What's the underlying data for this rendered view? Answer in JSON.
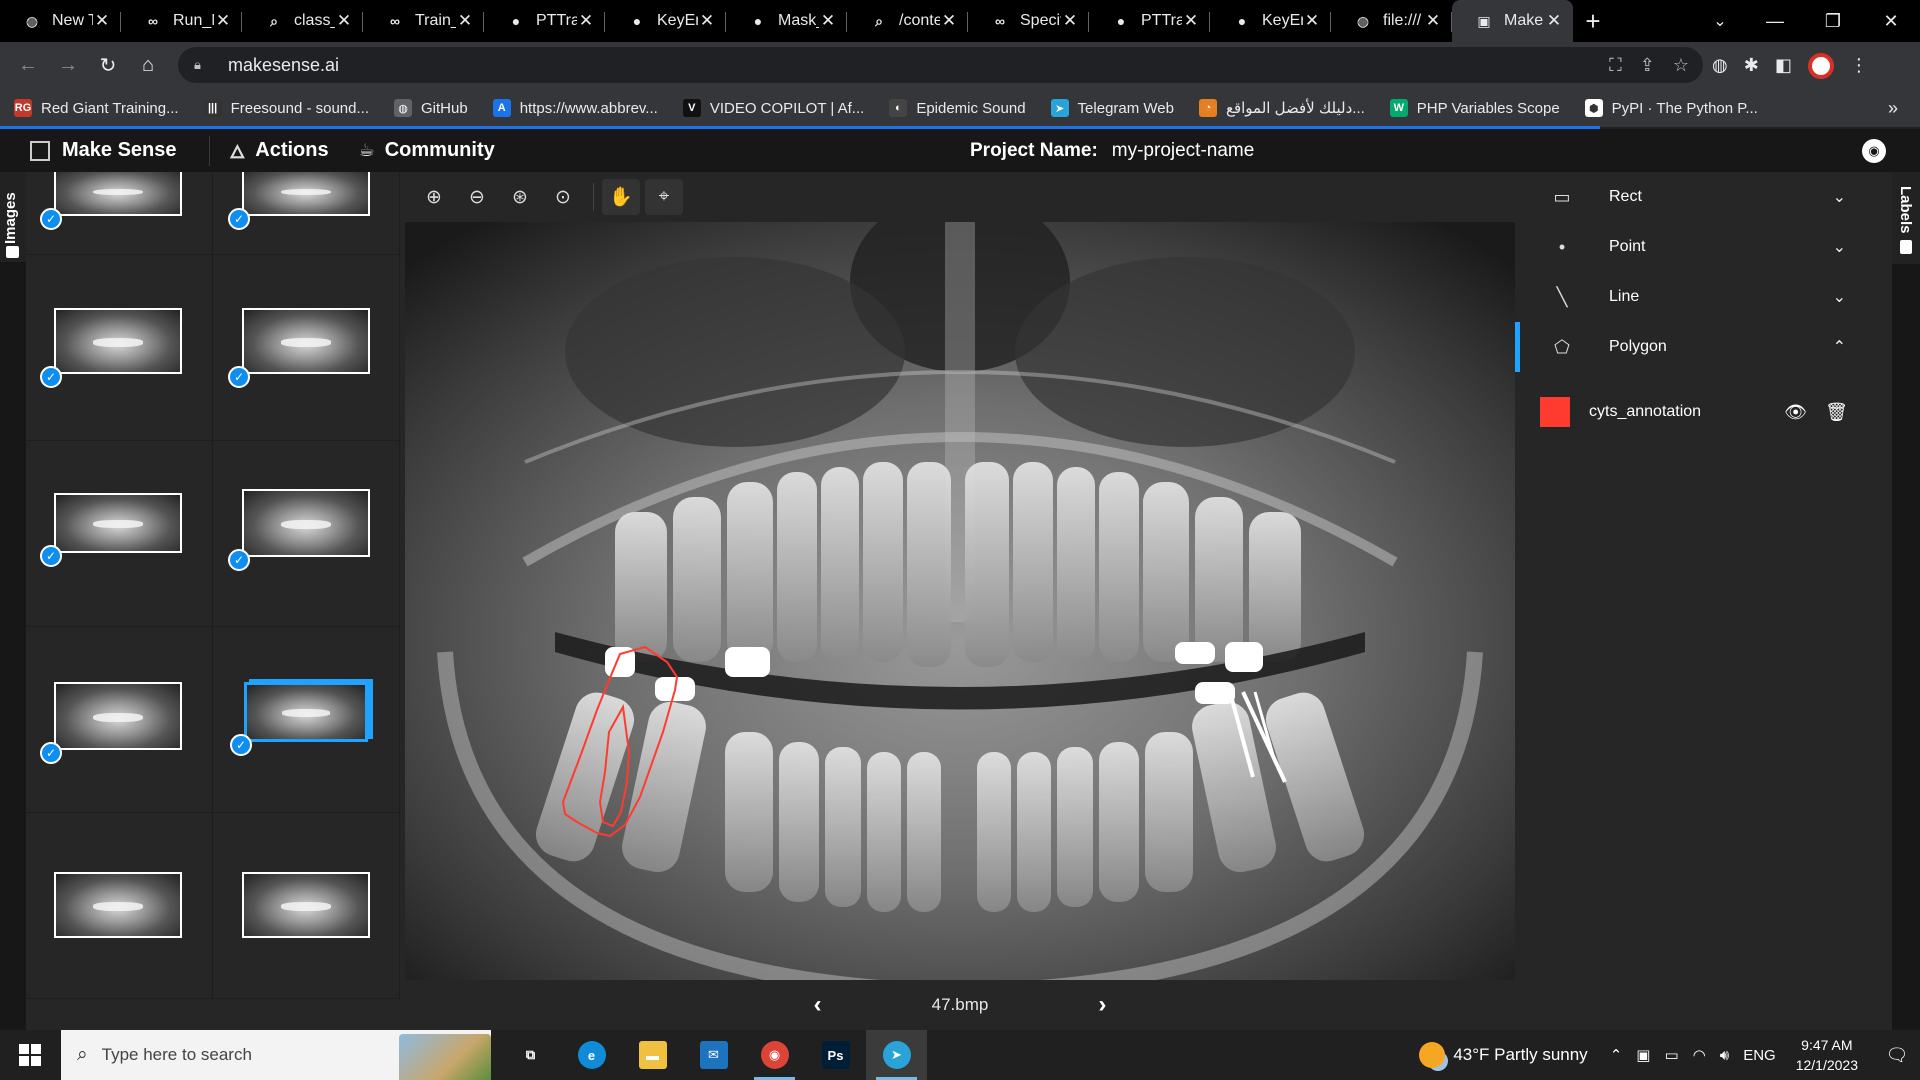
{
  "browser": {
    "tabs": [
      {
        "title": "New T",
        "icon": "globe-icon",
        "glyph": "◍"
      },
      {
        "title": "Run_N",
        "icon": "colab-icon",
        "glyph": "∞"
      },
      {
        "title": "class_i",
        "icon": "search-icon",
        "glyph": "⌕"
      },
      {
        "title": "Train_",
        "icon": "colab-icon",
        "glyph": "∞"
      },
      {
        "title": "PTTra:",
        "icon": "github-icon",
        "glyph": "●"
      },
      {
        "title": "KeyEr",
        "icon": "github-icon",
        "glyph": "●"
      },
      {
        "title": "Mask_",
        "icon": "github-icon",
        "glyph": "●"
      },
      {
        "title": "/conte",
        "icon": "search-icon",
        "glyph": "⌕"
      },
      {
        "title": "Specif",
        "icon": "colab-icon",
        "glyph": "∞"
      },
      {
        "title": "PTTra:",
        "icon": "github-icon",
        "glyph": "●"
      },
      {
        "title": "KeyEr",
        "icon": "github-icon",
        "glyph": "●"
      },
      {
        "title": "file:///",
        "icon": "globe-icon",
        "glyph": "◍"
      },
      {
        "title": "Make",
        "icon": "makesense-icon",
        "glyph": "▣",
        "active": true
      }
    ],
    "close_glyph": "✕",
    "new_tab_glyph": "+",
    "url": "makesense.ai",
    "bookmarks": [
      {
        "label": "Red Giant Training...",
        "icon": "red-giant-icon",
        "color": "#c0392b",
        "glyph": "RG"
      },
      {
        "label": "Freesound - sound...",
        "icon": "freesound-icon",
        "color": "#333333",
        "glyph": "|||"
      },
      {
        "label": "GitHub",
        "icon": "globe-icon",
        "color": "#5f6368",
        "glyph": "◍"
      },
      {
        "label": "https://www.abbrev...",
        "icon": "abbreviations-icon",
        "color": "#1a73e8",
        "glyph": "A"
      },
      {
        "label": "VIDEO COPILOT | Af...",
        "icon": "video-copilot-icon",
        "color": "#111111",
        "glyph": "V"
      },
      {
        "label": "Epidemic Sound",
        "icon": "epidemic-sound-icon",
        "color": "#444444",
        "glyph": "◐"
      },
      {
        "label": "Telegram Web",
        "icon": "telegram-icon",
        "color": "#2aa3d8",
        "glyph": "➤"
      },
      {
        "label": "دليلك لأفضل المواقع...",
        "icon": "guide-icon",
        "color": "#e67e22",
        "glyph": "◔"
      },
      {
        "label": "PHP Variables Scope",
        "icon": "w3schools-icon",
        "color": "#04aa6d",
        "glyph": "W"
      },
      {
        "label": "PyPI · The Python P...",
        "icon": "pypi-icon",
        "color": "#ffffff",
        "glyph": "⬢"
      }
    ],
    "bookmarks_more": "»"
  },
  "app": {
    "brand": "Make Sense",
    "menu": [
      {
        "label": "Actions",
        "icon": "rocket-icon",
        "glyph": "🜂"
      },
      {
        "label": "Community",
        "icon": "community-icon",
        "glyph": "☕"
      }
    ],
    "project_label": "Project Name:",
    "project_name": "my-project-name",
    "github_glyph": "◉"
  },
  "left_panel": {
    "tab_label": "Images",
    "thumbnails": [
      {
        "checked": true,
        "selected": false
      },
      {
        "checked": true,
        "selected": false
      },
      {
        "checked": true,
        "selected": false
      },
      {
        "checked": true,
        "selected": false
      },
      {
        "checked": true,
        "selected": false
      },
      {
        "checked": true,
        "selected": false
      },
      {
        "checked": true,
        "selected": false
      },
      {
        "checked": true,
        "selected": true
      },
      {
        "checked": false,
        "selected": false
      },
      {
        "checked": false,
        "selected": false
      }
    ]
  },
  "editor": {
    "tools": [
      {
        "name": "zoom-in-icon",
        "glyph": "⊕"
      },
      {
        "name": "zoom-out-icon",
        "glyph": "⊖"
      },
      {
        "name": "zoom-fit-icon",
        "glyph": "⊛"
      },
      {
        "name": "zoom-actual-icon",
        "glyph": "⊙"
      },
      {
        "name": "hand-icon",
        "glyph": "✋",
        "boxed": true
      },
      {
        "name": "crosshair-icon",
        "glyph": "⌖",
        "boxed": true
      }
    ],
    "filename": "47.bmp",
    "prev_glyph": "‹",
    "next_glyph": "›"
  },
  "right_panel": {
    "tab_label": "Labels",
    "tools": [
      {
        "label": "Rect",
        "icon": "rect-icon",
        "glyph": "▭",
        "chevron": "⌄",
        "active": false
      },
      {
        "label": "Point",
        "icon": "point-icon",
        "glyph": "•",
        "chevron": "⌄",
        "active": false
      },
      {
        "label": "Line",
        "icon": "line-icon",
        "glyph": "╲",
        "chevron": "⌄",
        "active": false
      },
      {
        "label": "Polygon",
        "icon": "polygon-icon",
        "glyph": "⬠",
        "chevron": "⌃",
        "active": true
      }
    ],
    "label": {
      "name": "cyts_annotation",
      "color": "#ff3b30"
    }
  },
  "taskbar": {
    "search_placeholder": "Type here to search",
    "weather": "43°F  Partly sunny",
    "language": "ENG",
    "time": "9:47 AM",
    "date": "12/1/2023",
    "apps": [
      {
        "name": "task-view-icon",
        "glyph": "⧉",
        "color": "transparent",
        "running": false
      },
      {
        "name": "edge-icon",
        "glyph": "e",
        "color": "#0f8bd8",
        "running": false
      },
      {
        "name": "file-explorer-icon",
        "glyph": "▬",
        "color": "#f0c040",
        "running": false
      },
      {
        "name": "mail-icon",
        "glyph": "✉",
        "color": "#1e73be",
        "running": false
      },
      {
        "name": "chrome-icon",
        "glyph": "◉",
        "color": "#db4437",
        "running": true
      },
      {
        "name": "photoshop-icon",
        "glyph": "Ps",
        "color": "#001e36",
        "running": false
      },
      {
        "name": "telegram-app-icon",
        "glyph": "➤",
        "color": "#2aa3d8",
        "running": true,
        "focus": true
      }
    ]
  }
}
